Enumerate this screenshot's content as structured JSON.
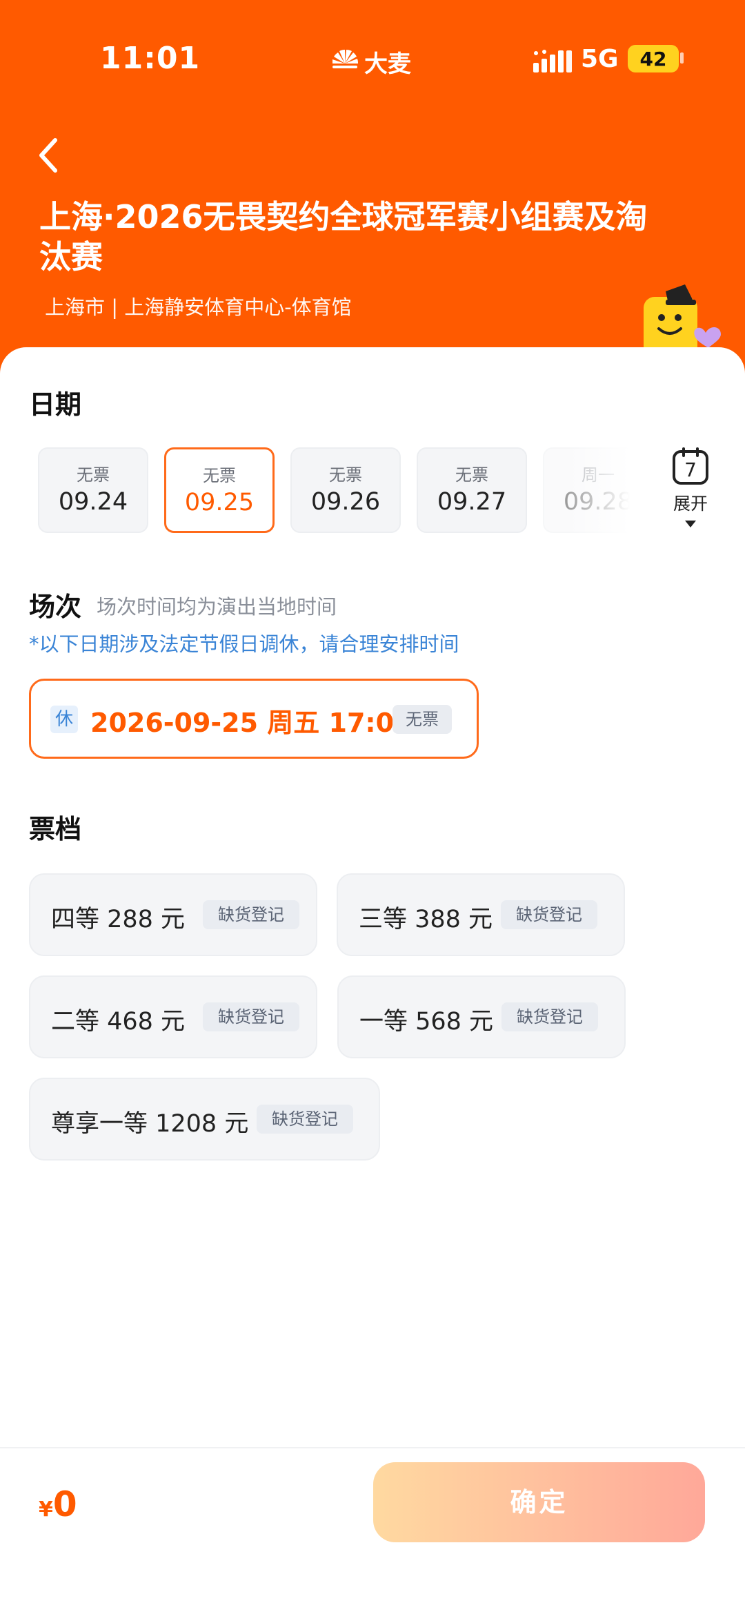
{
  "status_bar": {
    "time": "11:01",
    "brand": "大麦",
    "network": "5G",
    "battery": "42"
  },
  "header": {
    "title": "上海·2026无畏契约全球冠军赛小组赛及淘汰赛",
    "venue": "上海市 | 上海静安体育中心-体育馆"
  },
  "date_section": {
    "title": "日期",
    "dates": [
      {
        "status": "无票",
        "date": "09.24"
      },
      {
        "status": "无票",
        "date": "09.25",
        "selected": true
      },
      {
        "status": "无票",
        "date": "09.26"
      },
      {
        "status": "无票",
        "date": "09.27"
      },
      {
        "status": "周一",
        "date": "09.28"
      }
    ],
    "expand_number": "7",
    "expand_label": "展开"
  },
  "session_section": {
    "title": "场次",
    "note": "场次时间均为演出当地时间",
    "holiday_note": "*以下日期涉及法定节假日调休，请合理安排时间",
    "session": {
      "badge": "休",
      "datetime": "2026-09-25 周五 17:00",
      "tag": "无票"
    }
  },
  "ticket_section": {
    "title": "票档",
    "tiers": [
      {
        "label": "四等 288 元",
        "tag": "缺货登记"
      },
      {
        "label": "三等 388 元",
        "tag": "缺货登记"
      },
      {
        "label": "二等 468 元",
        "tag": "缺货登记"
      },
      {
        "label": "一等 568 元",
        "tag": "缺货登记"
      },
      {
        "label": "尊享一等 1208 元",
        "tag": "缺货登记"
      }
    ]
  },
  "bottom_bar": {
    "currency": "¥",
    "total": "0",
    "confirm_label": "确定"
  },
  "colors": {
    "brand_orange": "#ff5a00",
    "accent_blue": "#3a84d6",
    "battery_yellow": "#ffd21f"
  }
}
